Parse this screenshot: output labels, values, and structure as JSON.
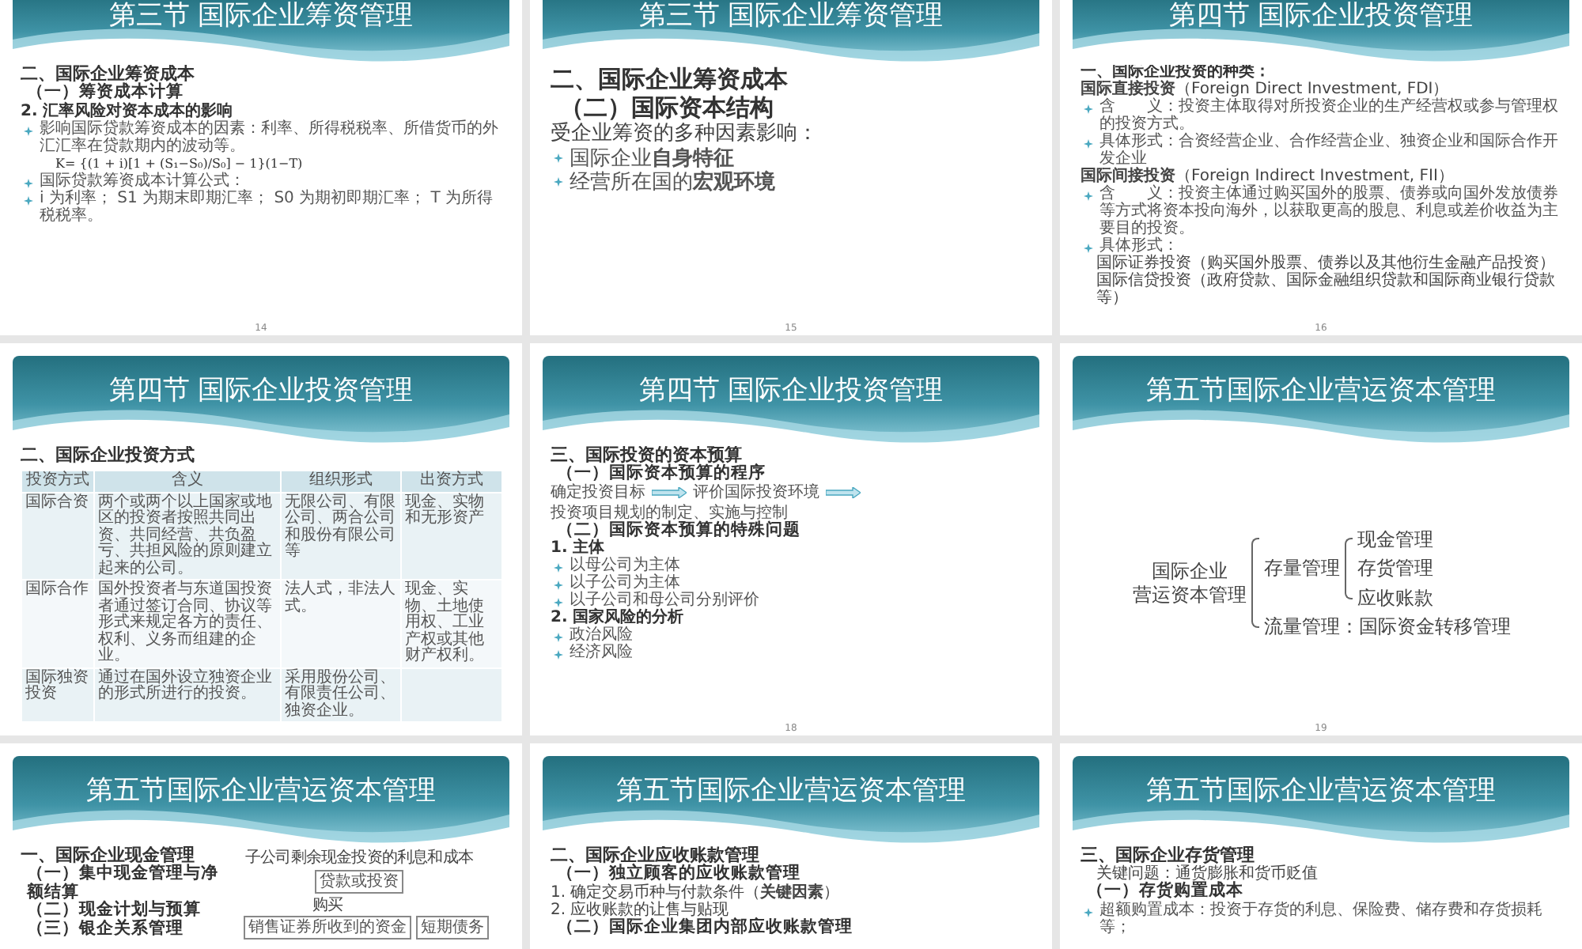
{
  "slides": [
    {
      "kind": "normal",
      "title": "第三节 国际企业筹资管理",
      "page": "14",
      "blocks": [
        {
          "kind": "h1",
          "text": "二、国际企业筹资成本"
        },
        {
          "kind": "h2",
          "text": "（一）筹资成本计算"
        },
        {
          "kind": "h3",
          "text": "2. 汇率风险对资本成本的影响"
        },
        {
          "kind": "bullet",
          "text": "影响国际贷款筹资成本的因素：利率、所得税税率、所借货币的外汇汇率在贷款期内的波动等。",
          "formula": "K= {(1 + i)[1 + (S₁−S₀)/S₀] − 1}(1−T)"
        },
        {
          "kind": "bullet",
          "text": "国际贷款筹资成本计算公式："
        },
        {
          "kind": "bullet",
          "text": "i 为利率； S1 为期末即期汇率； S0 为期初即期汇率； T 为所得税税率。"
        }
      ]
    },
    {
      "kind": "large",
      "title": "第三节 国际企业筹资管理",
      "page": "15",
      "blocks": [
        {
          "kind": "h1",
          "text": "二、国际企业筹资成本"
        },
        {
          "kind": "h2",
          "text": "（二）国际资本结构"
        },
        {
          "kind": "text",
          "text": "受企业筹资的多种因素影响："
        },
        {
          "kind": "bullet",
          "text": "国际企业**自身特征**"
        },
        {
          "kind": "bullet",
          "text": "经营所在国的**宏观环境**"
        }
      ]
    },
    {
      "kind": "normal",
      "title": "第四节 国际企业投资管理",
      "page": "16",
      "blocks": [
        {
          "kind": "h3",
          "text": "一、国际企业投资的种类："
        },
        {
          "kind": "text",
          "text": "**国际直接投资**（Foreign Direct Investment, FDI）"
        },
        {
          "kind": "bullet",
          "text": "含　　义：投资主体取得对所投资企业的生产经营权或参与管理权的投资方式。"
        },
        {
          "kind": "bullet",
          "text": "具体形式：合资经营企业、合作经营企业、独资企业和国际合作开发企业"
        },
        {
          "kind": "text",
          "text": "**国际间接投资**（Foreign Indirect Investment, FII）"
        },
        {
          "kind": "bullet",
          "text": "含　　义：投资主体通过购买国外的股票、债券或向国外发放债券等方式将资本投向海外，以获取更高的股息、利息或差价收益为主要目的投资。"
        },
        {
          "kind": "bullet",
          "text": "具体形式："
        },
        {
          "kind": "indent",
          "text": "国际证券投资（购买国外股票、债券以及其他衍生金融产品投资）"
        },
        {
          "kind": "indent",
          "text": "国际信贷投资（政府贷款、国际金融组织贷款和国际商业银行贷款等）"
        }
      ]
    },
    {
      "kind": "normal",
      "title": "第四节 国际企业投资管理",
      "blocks": [
        {
          "kind": "h1",
          "text": "二、国际企业投资方式"
        },
        {
          "kind": "table",
          "columns": [
            "投资方式",
            "含义",
            "组织形式",
            "出资方式"
          ],
          "rows": [
            [
              "国际合资",
              "两个或两个以上国家或地区的投资者按照共同出资、共同经营、共负盈亏、共担风险的原则建立起来的公司。",
              "无限公司、有限公司、两合公司和股份有限公司等",
              "现金、实物和无形资产"
            ],
            [
              "国际合作",
              "国外投资者与东道国投资者通过签订合同、协议等形式来规定各方的责任、权利、义务而组建的企业。",
              "法人式，非法人式。",
              "现金、实物、土地使用权、工业产权或其他财产权利。"
            ],
            [
              "国际独资投资",
              "通过在国外设立独资企业的形式所进行的投资。",
              "采用股份公司、有限责任公司、独资企业。",
              ""
            ]
          ]
        }
      ]
    },
    {
      "kind": "normal",
      "title": "第四节 国际企业投资管理",
      "page": "18",
      "blocks": [
        {
          "kind": "h1",
          "text": "三、国际投资的资本预算"
        },
        {
          "kind": "h2",
          "text": "（一）国际资本预算的程序"
        },
        {
          "kind": "flow",
          "steps": [
            "确定投资目标",
            "评价国际投资环境",
            "投资项目规划的制定、实施与控制"
          ]
        },
        {
          "kind": "h2",
          "text": "（二）国际资本预算的特殊问题"
        },
        {
          "kind": "h3",
          "text": "1. 主体"
        },
        {
          "kind": "bullet",
          "text": "以母公司为主体"
        },
        {
          "kind": "bullet",
          "text": "以子公司为主体"
        },
        {
          "kind": "bullet",
          "text": "以子公司和母公司分别评价"
        },
        {
          "kind": "h3",
          "text": "2. 国家风险的分析"
        },
        {
          "kind": "bullet",
          "text": "政治风险"
        },
        {
          "kind": "bullet",
          "text": "经济风险"
        }
      ]
    },
    {
      "kind": "normal",
      "title": "第五节国际企业营运资本管理",
      "page": "19",
      "blocks": [
        {
          "kind": "tree",
          "label_lines": [
            "国际企业",
            "营运资本管理"
          ],
          "children": [
            {
              "label": "存量管理",
              "children": [
                {
                  "label": "现金管理"
                },
                {
                  "label": "存货管理"
                },
                {
                  "label": "应收账款"
                }
              ]
            },
            {
              "label": "流量管理：国际资金转移管理"
            }
          ]
        }
      ]
    },
    {
      "kind": "split",
      "title": "第五节国际企业营运资本管理",
      "blocks": [
        {
          "kind": "h1",
          "text": "一、国际企业现金管理"
        },
        {
          "kind": "h2",
          "text": "（一）集中现金管理与净额结算"
        },
        {
          "kind": "h2",
          "text": "（二）现金计划与预算"
        },
        {
          "kind": "h2",
          "text": "（三）银企关系管理"
        },
        {
          "kind": "diagram",
          "boxes": [
            {
              "caption": "子公司剩余现金投资的利息和成本",
              "label": "贷款或投资"
            },
            {
              "caption": "购买",
              "label": "销售证券所收到的资金"
            },
            {
              "label": "短期债务"
            }
          ]
        }
      ]
    },
    {
      "kind": "normal",
      "title": "第五节国际企业营运资本管理",
      "blocks": [
        {
          "kind": "h1",
          "text": "二、国际企业应收账款管理"
        },
        {
          "kind": "h2",
          "text": "（一）独立顾客的应收账款管理"
        },
        {
          "kind": "text",
          "text": "1. 确定交易币种与付款条件（**关键因素**）"
        },
        {
          "kind": "text",
          "text": "2. 应收账款的让售与贴现"
        },
        {
          "kind": "h2",
          "text": "（二）国际企业集团内部应收账款管理"
        }
      ]
    },
    {
      "kind": "normal",
      "title": "第五节国际企业营运资本管理",
      "blocks": [
        {
          "kind": "h1",
          "text": "三、国际企业存货管理"
        },
        {
          "kind": "indent",
          "text": "关键问题：通货膨胀和货币贬值"
        },
        {
          "kind": "h2",
          "text": "（一）存货购置成本"
        },
        {
          "kind": "bullet",
          "text": "超额购置成本：投资于存货的利息、保险费、储存费和存货损耗等；"
        }
      ]
    }
  ]
}
